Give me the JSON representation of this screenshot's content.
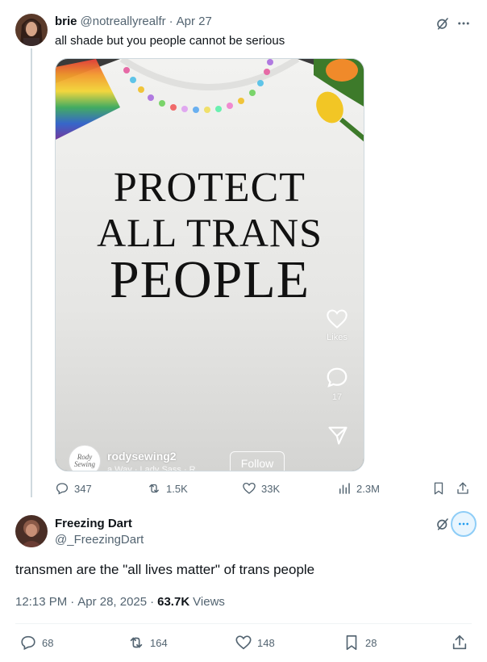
{
  "tweet1": {
    "display_name": "brie",
    "handle": "@notreallyrealfr",
    "separator": "·",
    "date": "Apr 27",
    "text": "all shade but you people cannot be serious",
    "media": {
      "shirt_line1": "PROTECT",
      "shirt_line2": "ALL TRANS",
      "shirt_line3": "PEOPLE",
      "overlay_likes_label": "Likes",
      "overlay_comments_count": "17",
      "creator_name": "rodysewing2",
      "creator_avatar_text": "Rody Sewing",
      "follow_label": "Follow",
      "cut_text": "a Way · Lady Sass · R"
    },
    "actions": {
      "replies": "347",
      "reposts": "1.5K",
      "likes": "33K",
      "views": "2.3M"
    }
  },
  "tweet2": {
    "display_name": "Freezing Dart",
    "handle": "@_FreezingDart",
    "text": "transmen are the \"all lives matter\" of trans people",
    "time": "12:13 PM",
    "separator": "·",
    "date": "Apr 28, 2025",
    "views_count": "63.7K",
    "views_label": "Views",
    "actions": {
      "replies": "68",
      "reposts": "164",
      "likes": "148",
      "bookmarks": "28"
    }
  },
  "colors": {
    "text_primary": "#0f1419",
    "text_secondary": "#536471",
    "accent": "#1d9bf0",
    "divider": "#eff3f4"
  },
  "icons": [
    "grok-slash-icon",
    "more-icon",
    "heart-icon",
    "comment-icon",
    "send-icon",
    "reply-icon",
    "repost-icon",
    "like-icon",
    "views-icon",
    "bookmark-icon",
    "share-icon"
  ]
}
